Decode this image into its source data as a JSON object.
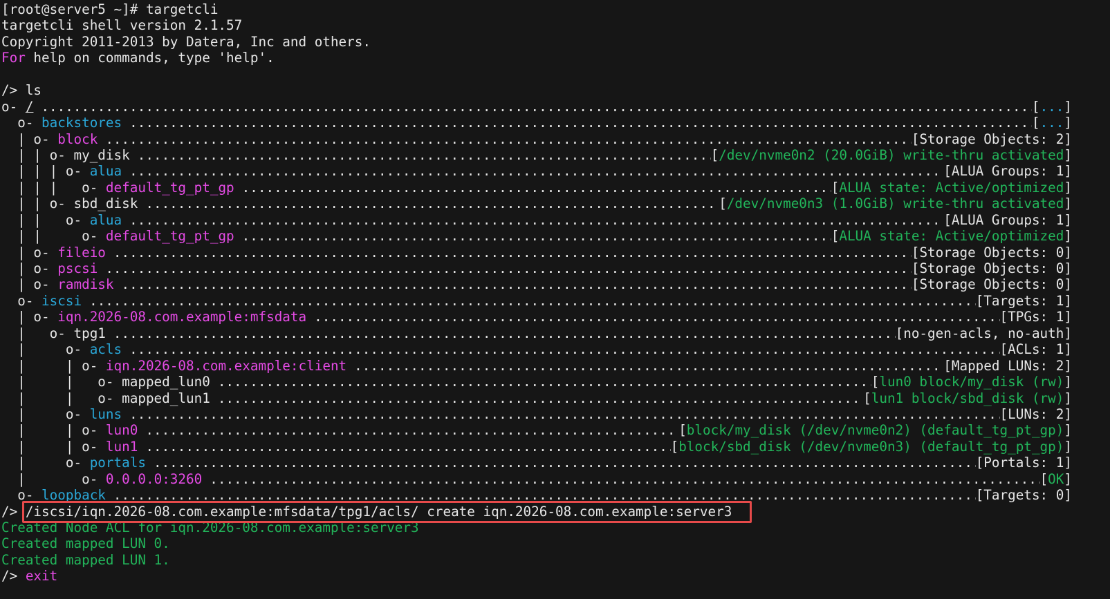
{
  "colors": {
    "background": "#161616",
    "default": "#e6e6e6",
    "magenta": "#e54be5",
    "cyan": "#2aa7d8",
    "green": "#22b55a",
    "highlight": "#e64a4a"
  },
  "header_lines": [
    [
      {
        "t": "[root@server5 ~]# targetcli",
        "c": "default"
      }
    ],
    [
      {
        "t": "targetcli shell version 2.1.57",
        "c": "default"
      }
    ],
    [
      {
        "t": "Copyright 2011-2013 by Datera, Inc and others.",
        "c": "default"
      }
    ],
    [
      {
        "t": "For",
        "c": "magenta"
      },
      {
        "t": " help on commands, type 'help'.",
        "c": "default"
      }
    ],
    [],
    [
      {
        "t": "/> ls",
        "c": "default"
      }
    ]
  ],
  "tree_rows": [
    {
      "prefix": "o- ",
      "name": "/",
      "nc": "default",
      "open": "[",
      "status": "...",
      "sc": "cyan",
      "close": "]"
    },
    {
      "prefix": "  o- ",
      "name": "backstores",
      "nc": "cyan",
      "open": "[",
      "status": "...",
      "sc": "cyan",
      "close": "]"
    },
    {
      "prefix": "  | o- ",
      "name": "block",
      "nc": "magenta",
      "open": "[",
      "status": "Storage Objects: 2",
      "sc": "default",
      "close": "]"
    },
    {
      "prefix": "  | | o- ",
      "name": "my_disk",
      "nc": "default",
      "open": "[",
      "status": "/dev/nvme0n2 (20.0GiB) write-thru activated",
      "sc": "green",
      "close": "]"
    },
    {
      "prefix": "  | | | o- ",
      "name": "alua",
      "nc": "cyan",
      "open": "[",
      "status": "ALUA Groups: 1",
      "sc": "default",
      "close": "]"
    },
    {
      "prefix": "  | | |   o- ",
      "name": "default_tg_pt_gp",
      "nc": "magenta",
      "open": "[",
      "status": "ALUA state: Active/optimized",
      "sc": "green",
      "close": "]"
    },
    {
      "prefix": "  | | o- ",
      "name": "sbd_disk",
      "nc": "default",
      "open": "[",
      "status": "/dev/nvme0n3 (1.0GiB) write-thru activated",
      "sc": "green",
      "close": "]"
    },
    {
      "prefix": "  | |   o- ",
      "name": "alua",
      "nc": "cyan",
      "open": "[",
      "status": "ALUA Groups: 1",
      "sc": "default",
      "close": "]"
    },
    {
      "prefix": "  | |     o- ",
      "name": "default_tg_pt_gp",
      "nc": "magenta",
      "open": "[",
      "status": "ALUA state: Active/optimized",
      "sc": "green",
      "close": "]"
    },
    {
      "prefix": "  | o- ",
      "name": "fileio",
      "nc": "magenta",
      "open": "[",
      "status": "Storage Objects: 0",
      "sc": "default",
      "close": "]"
    },
    {
      "prefix": "  | o- ",
      "name": "pscsi",
      "nc": "magenta",
      "open": "[",
      "status": "Storage Objects: 0",
      "sc": "default",
      "close": "]"
    },
    {
      "prefix": "  | o- ",
      "name": "ramdisk",
      "nc": "magenta",
      "open": "[",
      "status": "Storage Objects: 0",
      "sc": "default",
      "close": "]"
    },
    {
      "prefix": "  o- ",
      "name": "iscsi",
      "nc": "cyan",
      "open": "[",
      "status": "Targets: 1",
      "sc": "default",
      "close": "]"
    },
    {
      "prefix": "  | o- ",
      "name": "iqn.2026-08.com.example:mfsdata",
      "nc": "magenta",
      "open": "[",
      "status": "TPGs: 1",
      "sc": "default",
      "close": "]"
    },
    {
      "prefix": "  |   o- ",
      "name": "tpg1",
      "nc": "default",
      "open": "[",
      "status": "no-gen-acls, no-auth",
      "sc": "default",
      "close": "]"
    },
    {
      "prefix": "  |     o- ",
      "name": "acls",
      "nc": "cyan",
      "open": "[",
      "status": "ACLs: 1",
      "sc": "default",
      "close": "]"
    },
    {
      "prefix": "  |     | o- ",
      "name": "iqn.2026-08.com.example:client",
      "nc": "magenta",
      "open": "[",
      "status": "Mapped LUNs: 2",
      "sc": "default",
      "close": "]"
    },
    {
      "prefix": "  |     |   o- ",
      "name": "mapped_lun0",
      "nc": "default",
      "open": "[",
      "status": "lun0 block/my_disk (rw)",
      "sc": "green",
      "close": "]"
    },
    {
      "prefix": "  |     |   o- ",
      "name": "mapped_lun1",
      "nc": "default",
      "open": "[",
      "status": "lun1 block/sbd_disk (rw)",
      "sc": "green",
      "close": "]"
    },
    {
      "prefix": "  |     o- ",
      "name": "luns",
      "nc": "cyan",
      "open": "[",
      "status": "LUNs: 2",
      "sc": "default",
      "close": "]"
    },
    {
      "prefix": "  |     | o- ",
      "name": "lun0",
      "nc": "magenta",
      "open": "[",
      "status": "block/my_disk (/dev/nvme0n2) (default_tg_pt_gp)",
      "sc": "green",
      "close": "]"
    },
    {
      "prefix": "  |     | o- ",
      "name": "lun1",
      "nc": "magenta",
      "open": "[",
      "status": "block/sbd_disk (/dev/nvme0n3) (default_tg_pt_gp)",
      "sc": "green",
      "close": "]"
    },
    {
      "prefix": "  |     o- ",
      "name": "portals",
      "nc": "cyan",
      "open": "[",
      "status": "Portals: 1",
      "sc": "default",
      "close": "]"
    },
    {
      "prefix": "  |       o- ",
      "name": "0.0.0.0:3260",
      "nc": "magenta",
      "open": "[",
      "status": "OK",
      "sc": "green",
      "close": "]"
    },
    {
      "prefix": "  o- ",
      "name": "loopback",
      "nc": "cyan",
      "open": "[",
      "status": "Targets: 0",
      "sc": "default",
      "close": "]"
    }
  ],
  "command": {
    "prompt": "/> ",
    "text": "/iscsi/iqn.2026-08.com.example:mfsdata/tpg1/acls/ create iqn.2026-08.com.example:server3"
  },
  "output_lines": [
    "Created Node ACL for iqn.2026-08.com.example:server3",
    "Created mapped LUN 0.",
    "Created mapped LUN 1."
  ],
  "final": {
    "prompt": "/> ",
    "command": "exit"
  }
}
